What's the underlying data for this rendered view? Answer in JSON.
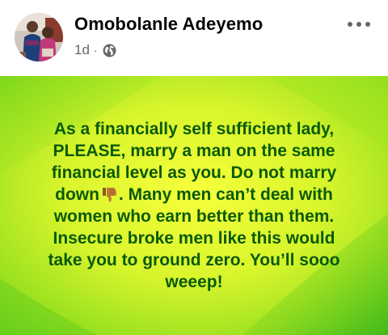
{
  "post": {
    "author_name": "Omobolanle Adeyemo",
    "timestamp": "1d",
    "separator": "·",
    "privacy_icon": "globe-icon",
    "more_icon": "more-dots-icon",
    "avatar_icon": "profile-photo",
    "body": {
      "text_part1": "As a financially self sufficient lady,\nPLEASE, marry a man on the same\nfinancial level as you. Do not marry\ndown",
      "emoji": "thumbs-down-emoji",
      "text_part2": ". Many men can’t deal with\nwomen who earn better than them.\nInsecure broke men like this would\ntake you to ground zero. You’ll sooo\nweeep!",
      "text_color": "#0a5a0a",
      "background_colors": [
        "#f4ff3a",
        "#a8ec22",
        "#3fbd1a"
      ]
    }
  }
}
